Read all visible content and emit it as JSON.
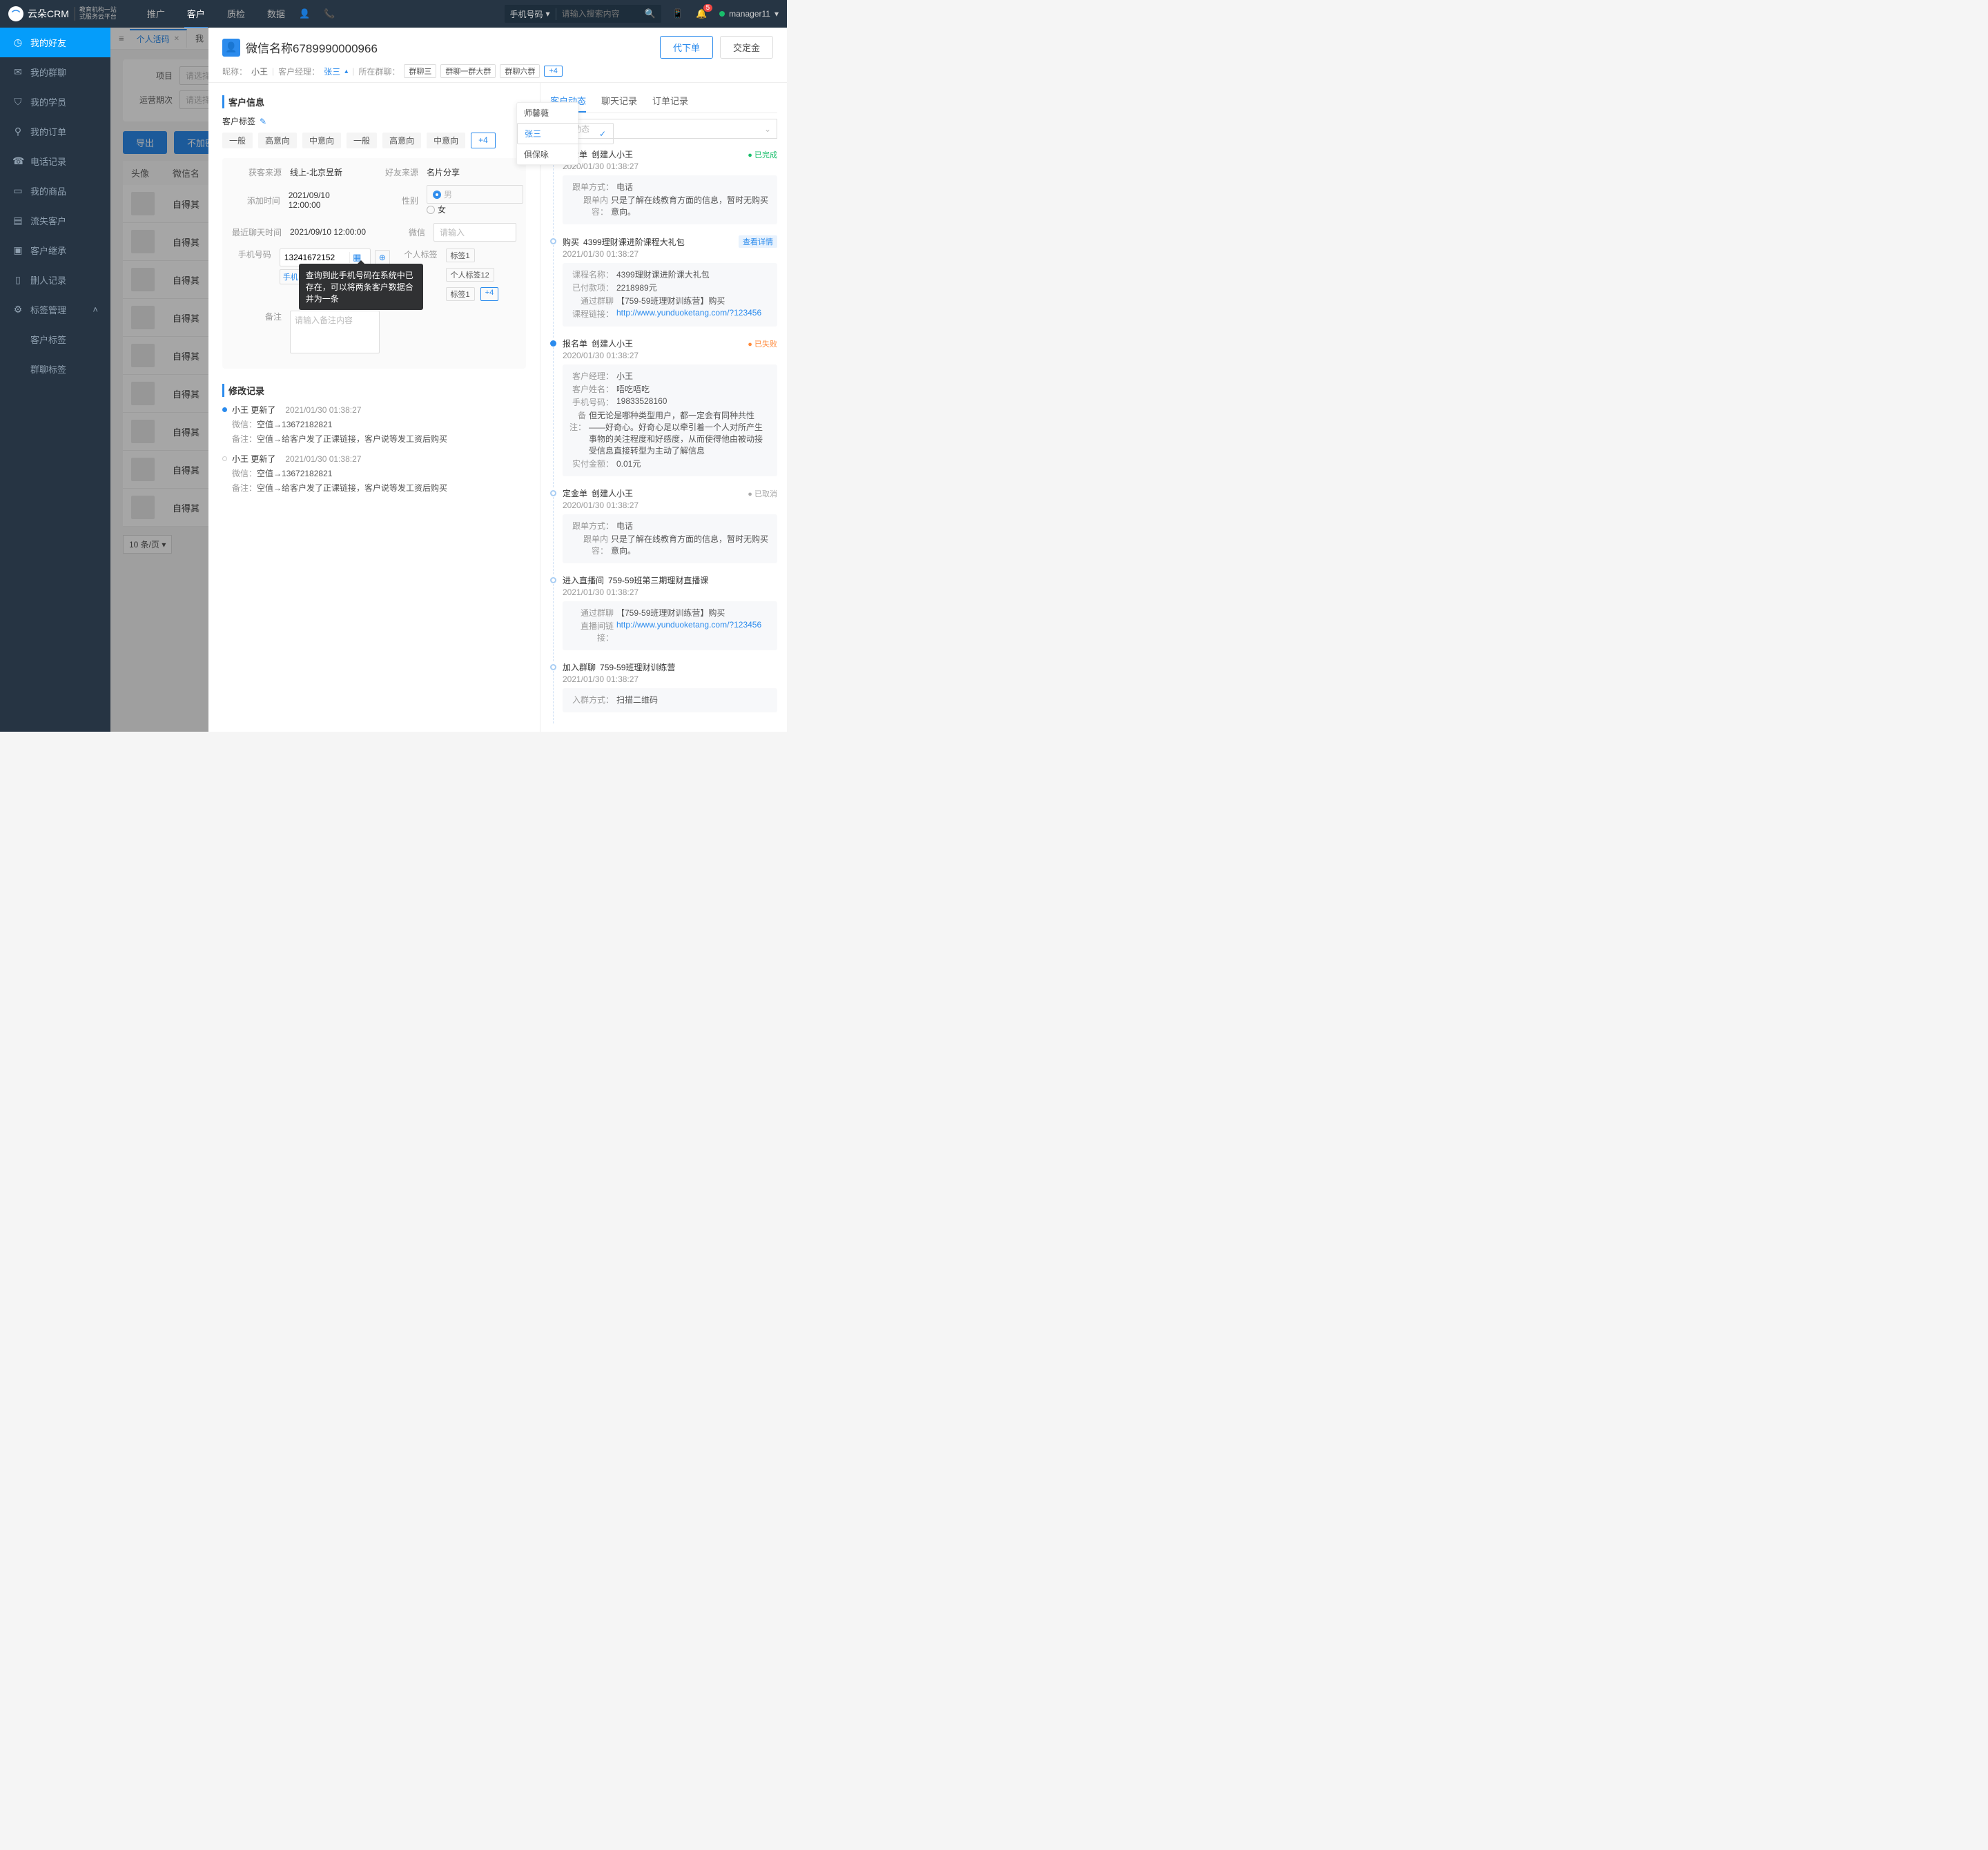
{
  "topbar": {
    "logo_main": "云朵CRM",
    "logo_sub1": "教育机构一站",
    "logo_sub2": "式服务云平台",
    "nav": [
      "推广",
      "客户",
      "质检",
      "数据"
    ],
    "search_type": "手机号码",
    "search_placeholder": "请输入搜索内容",
    "badge": "5",
    "user": "manager11"
  },
  "sidebar": {
    "items": [
      "我的好友",
      "我的群聊",
      "我的学员",
      "我的订单",
      "电话记录",
      "我的商品",
      "流失客户",
      "客户继承",
      "删人记录",
      "标签管理"
    ],
    "subitems": [
      "客户标签",
      "群聊标签"
    ]
  },
  "tabs": {
    "active": "个人活码",
    "next": "我"
  },
  "filters": {
    "project_lbl": "项目",
    "period_lbl": "运营期次",
    "placeholder": "请选择"
  },
  "list": {
    "export": "导出",
    "noenc": "不加密导出",
    "col_av": "头像",
    "col_name": "微信名",
    "row_name": "自得其",
    "pager": "10 条/页"
  },
  "drawer": {
    "title": "微信名称6789990000966",
    "nick_lbl": "昵称：",
    "nick": "小王",
    "mgr_lbl": "客户经理：",
    "mgr": "张三",
    "grp_lbl": "所在群聊：",
    "groups": [
      "群聊三",
      "群聊一群大群",
      "群聊六群"
    ],
    "groups_more": "+4",
    "btn_order": "代下单",
    "btn_deposit": "交定金",
    "dropdown": {
      "items": [
        "师馨薇",
        "张三",
        "俱保咏"
      ],
      "sel": 1
    }
  },
  "custinfo": {
    "section": "客户信息",
    "tags_lbl": "客户标签",
    "tags": [
      "一般",
      "高意向",
      "中意向",
      "一般",
      "高意向",
      "中意向"
    ],
    "tags_more": "+4",
    "src_lbl": "获客来源",
    "src": "线上-北京昱新",
    "friend_lbl": "好友来源",
    "friend": "名片分享",
    "add_lbl": "添加时间",
    "add": "2021/09/10 12:00:00",
    "sex_lbl": "性别",
    "male": "男",
    "female": "女",
    "chat_lbl": "最近聊天时间",
    "chat": "2021/09/10 12:00:00",
    "wx_lbl": "微信",
    "wx_ph": "请输入",
    "phone_lbl": "手机号码",
    "phone": "13241672152",
    "phone_sel": "手机",
    "ptag_lbl": "个人标签",
    "ptags": [
      "标签1",
      "个人标签12",
      "标签1"
    ],
    "ptags_more": "+4",
    "remark_lbl": "备注",
    "remark_ph": "请输入备注内容",
    "tooltip": "查询到此手机号码在系统中已存在，可以将两条客户数据合并为一条"
  },
  "modlog": {
    "section": "修改记录",
    "items": [
      {
        "who": "小王 更新了",
        "time": "2021/01/30  01:38:27",
        "lines": [
          [
            "微信：",
            "空值→13672182821"
          ],
          [
            "备注：",
            "空值→给客户发了正课链接，客户说等发工资后购买"
          ]
        ]
      },
      {
        "who": "小王 更新了",
        "time": "2021/01/30  01:38:27",
        "lines": [
          [
            "微信：",
            "空值→13672182821"
          ],
          [
            "备注：",
            "空值→给客户发了正课链接，客户说等发工资后购买"
          ]
        ]
      }
    ]
  },
  "right": {
    "tabs": [
      "客户动态",
      "聊天记录",
      "订单记录"
    ],
    "filter": "全部动态",
    "acts": [
      {
        "dot": "solid",
        "title": "定金单",
        "sub": "创建人小王",
        "status": "已完成",
        "st": "done",
        "time": "2020/01/30  01:38:27",
        "card": [
          [
            "跟单方式：",
            "电话"
          ],
          [
            "跟单内容：",
            "只是了解在线教育方面的信息，暂时无购买意向。"
          ]
        ]
      },
      {
        "dot": "hollow",
        "title": "购买",
        "sub": "4399理财课进阶课程大礼包",
        "view": "查看详情",
        "time": "2021/01/30  01:38:27",
        "card": [
          [
            "课程名称：",
            "4399理财课进阶课大礼包"
          ],
          [
            "已付款项：",
            "2218989元"
          ],
          [
            "通过群聊",
            "【759-59班理财训练营】购买"
          ],
          [
            "课程链接：",
            "http://www.yunduoketang.com/?123456"
          ]
        ]
      },
      {
        "dot": "solid",
        "title": "报名单",
        "sub": "创建人小王",
        "status": "已失败",
        "st": "fail",
        "time": "2020/01/30  01:38:27",
        "card": [
          [
            "客户经理：",
            "小王"
          ],
          [
            "客户姓名：",
            "唔吃唔吃"
          ],
          [
            "手机号码：",
            "19833528160"
          ],
          [
            "备注：",
            "但无论是哪种类型用户，都一定会有同种共性——好奇心。好奇心足以牵引着一个人对所产生事物的关注程度和好感度，从而使得他由被动接受信息直接转型为主动了解信息"
          ],
          [
            "实付金额：",
            "0.01元"
          ]
        ]
      },
      {
        "dot": "hollow",
        "title": "定金单",
        "sub": "创建人小王",
        "status": "已取消",
        "st": "cancel",
        "time": "2020/01/30  01:38:27",
        "card": [
          [
            "跟单方式：",
            "电话"
          ],
          [
            "跟单内容：",
            "只是了解在线教育方面的信息，暂时无购买意向。"
          ]
        ]
      },
      {
        "dot": "hollow",
        "title": "进入直播间",
        "sub": "759-59班第三期理财直播课",
        "time": "2021/01/30  01:38:27",
        "card": [
          [
            "通过群聊",
            "【759-59班理财训练营】购买"
          ],
          [
            "直播间链接：",
            "http://www.yunduoketang.com/?123456"
          ]
        ]
      },
      {
        "dot": "hollow",
        "title": "加入群聊",
        "sub": "759-59班理财训练营",
        "time": "2021/01/30  01:38:27",
        "card": [
          [
            "入群方式：",
            "扫描二维码"
          ]
        ]
      }
    ]
  }
}
